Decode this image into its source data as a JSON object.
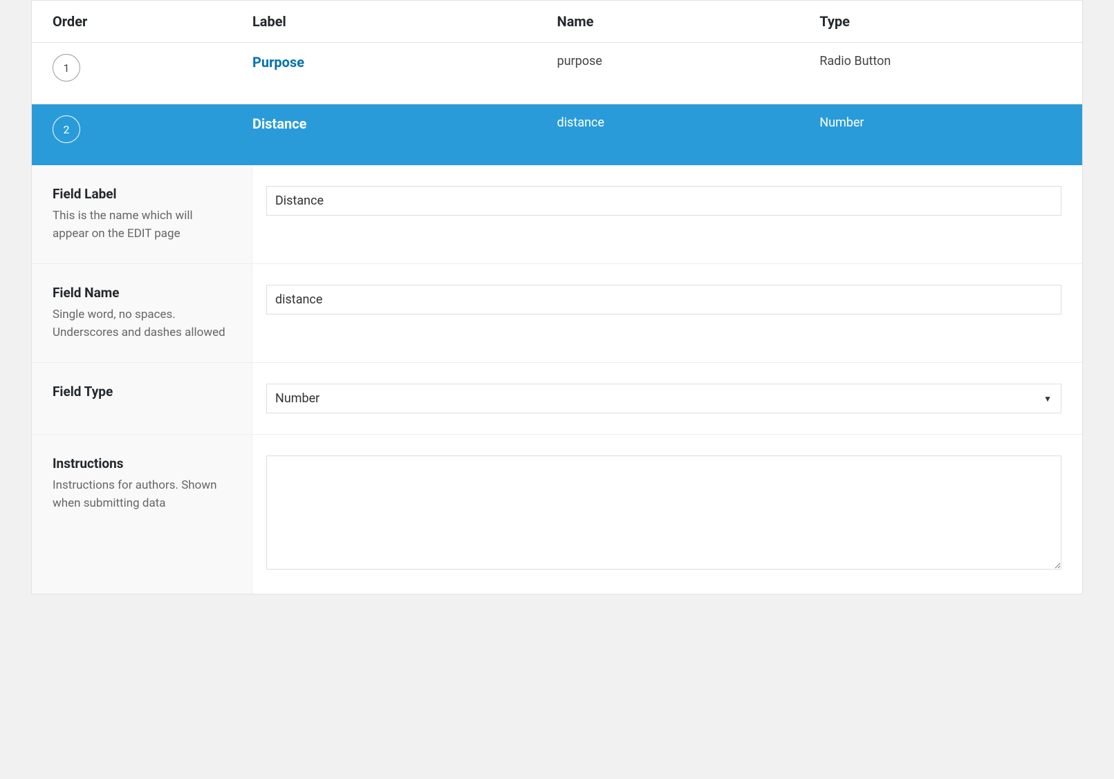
{
  "headers": {
    "order": "Order",
    "label": "Label",
    "name": "Name",
    "type": "Type"
  },
  "fields": [
    {
      "order": "1",
      "label": "Purpose",
      "name": "purpose",
      "type": "Radio Button"
    },
    {
      "order": "2",
      "label": "Distance",
      "name": "distance",
      "type": "Number"
    }
  ],
  "settings": {
    "field_label": {
      "title": "Field Label",
      "desc": "This is the name which will appear on the EDIT page",
      "value": "Distance"
    },
    "field_name": {
      "title": "Field Name",
      "desc": "Single word, no spaces. Underscores and dashes allowed",
      "value": "distance"
    },
    "field_type": {
      "title": "Field Type",
      "value": "Number"
    },
    "instructions": {
      "title": "Instructions",
      "desc": "Instructions for authors. Shown when submitting data",
      "value": ""
    }
  }
}
